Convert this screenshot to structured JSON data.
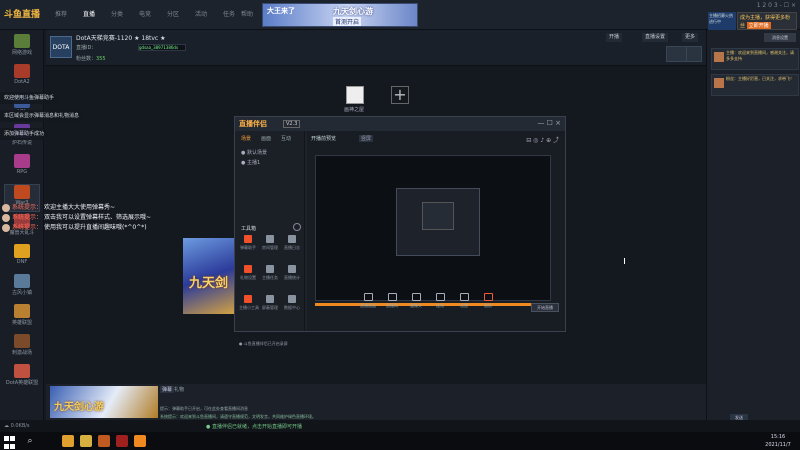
{
  "app": {
    "logo": "斗鱼直播",
    "nav_tabs": [
      "推荐",
      "直播",
      "分类",
      "电竞",
      "分区",
      "活动",
      "任务",
      "帮助"
    ],
    "active_tab_index": 1,
    "window_controls": "1 2 0 3 - ☐ ×"
  },
  "banner": {
    "title": "九天剑心游",
    "subtitle": "首测开启",
    "text": "大王来了"
  },
  "topright": {
    "ad": "主播招募火热进行中",
    "vip": "成为主播，获得更多粉丝",
    "vip_btn": "立即开播"
  },
  "sidebar": {
    "items": [
      {
        "label": "网络游戏",
        "color": "#5a7d3a"
      },
      {
        "label": "DotA2",
        "color": "#a83b2a"
      },
      {
        "label": "LOL",
        "color": "#3a5a9a"
      },
      {
        "label": "炉石传说",
        "color": "#6a3a9a"
      },
      {
        "label": "RPG",
        "color": "#a83b8a"
      },
      {
        "label": "War3",
        "color": "#c04a20"
      },
      {
        "label": "魔兽大乱斗",
        "color": "#9a3a3a"
      },
      {
        "label": "DNF",
        "color": "#e0a020"
      },
      {
        "label": "古风小镇",
        "color": "#5a7a9a"
      },
      {
        "label": "英雄联盟",
        "color": "#b88030"
      },
      {
        "label": "刺激战场",
        "color": "#7a4a2a"
      },
      {
        "label": "DotA英雄联盟",
        "color": "#c05040"
      }
    ]
  },
  "room": {
    "avatar_label": "DOTA",
    "title": "DotA天梯竞赛-1120 ★ 18tvc ★",
    "id_label": "直播ID：",
    "input_value": "gdsaa_38971386ds",
    "fans_label": "粉丝数：",
    "fans_value": "355",
    "btn_live": "开播",
    "btn_settings": "直播设置",
    "btn_more": "更多"
  },
  "stage": {
    "source_label": "画神之屋",
    "add_symbol": "+",
    "game_text": "九天剑"
  },
  "notes": [
    "欢迎使用斗鱼弹幕助手",
    "本区域会显示弹幕消息和礼物消息",
    "添加弹幕助手成功"
  ],
  "chat": [
    {
      "name": "系统提示：",
      "text": "欢迎主播大大使用弹幕秀~"
    },
    {
      "name": "系统提示：",
      "text": "双击我可以设置弹幕样式、筛选展示哦~"
    },
    {
      "name": "系统提示：",
      "text": "使用我可以提升直播间趣味哦(*^0^*)"
    }
  ],
  "helper": {
    "logo": "直播伴侣",
    "version": "V2.3",
    "left_tabs": [
      "场景",
      "画面",
      "互动"
    ],
    "left_rows": [
      "● 默认场景",
      "● 主播1"
    ],
    "tools_title": "工具箱",
    "tools": [
      {
        "label": "弹幕助手",
        "color": "#f0502a"
      },
      {
        "label": "房间管理",
        "color": "#8a93a0"
      },
      {
        "label": "直播日志",
        "color": "#8a93a0"
      },
      {
        "label": "礼物设置",
        "color": "#f0502a"
      },
      {
        "label": "主播任务",
        "color": "#8a93a0"
      },
      {
        "label": "直播统计",
        "color": "#8a93a0"
      },
      {
        "label": "主播小工具",
        "color": "#f0502a"
      },
      {
        "label": "屏蔽管理",
        "color": "#8a93a0"
      },
      {
        "label": "数据中心",
        "color": "#8a93a0"
      }
    ],
    "footer": "● 斗鱼直播伴侣已开启录屏",
    "main_tab1": "开播前预览",
    "main_tab2": "竖屏",
    "bottom_tools": [
      "直播画面",
      "直播间",
      "摄像头",
      "连线",
      "设置",
      "画质"
    ],
    "live_btn": "开始直播"
  },
  "right_messages": [
    {
      "text": "主播：欢迎来到直播间，感谢关注，请多多支持"
    },
    {
      "text": "粉丝：主播好厉害，已关注，求带飞！"
    }
  ],
  "right_chip": "消息设置",
  "bottom": {
    "img_text": "九天剑心游",
    "tab1": "弹幕",
    "tab2": "礼物",
    "msg": "提示：弹幕助手已开启，可在此处查看直播间消息",
    "input_hint": "系统提示：欢迎来到斗鱼直播间，请遵守直播规范，文明发言，共同维护绿色直播环境。",
    "send": "发送"
  },
  "status": {
    "left": "☁ 0.0KB/s",
    "right": "● 直播伴侣已就绪，点击开始直播即可开播"
  },
  "taskbar": {
    "time": "15:16",
    "date": "2021/11/7",
    "icons": [
      {
        "name": "chrome-icon",
        "color": "#e0a030"
      },
      {
        "name": "folder-icon",
        "color": "#d8b040"
      },
      {
        "name": "app-icon",
        "color": "#c05a20"
      },
      {
        "name": "dota-icon",
        "color": "#a02020"
      },
      {
        "name": "douyu-icon",
        "color": "#f08a20"
      }
    ]
  }
}
